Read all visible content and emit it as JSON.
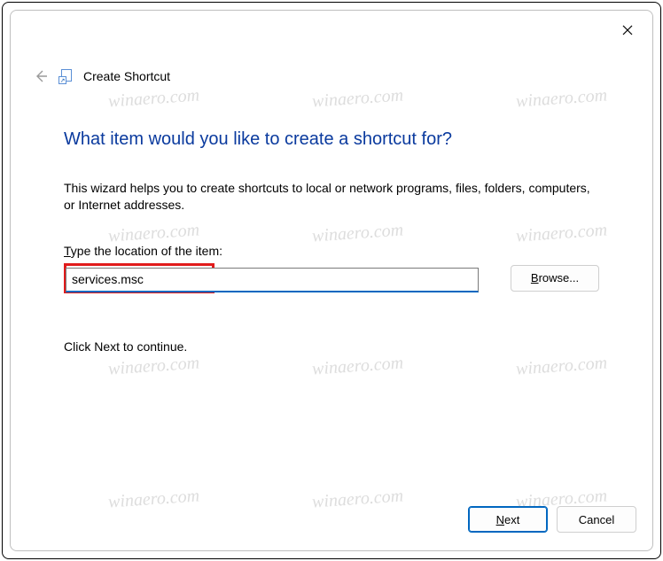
{
  "window": {
    "title": "Create Shortcut",
    "close_label": "Close"
  },
  "wizard": {
    "heading": "What item would you like to create a shortcut for?",
    "description": "This wizard helps you to create shortcuts to local or network programs, files, folders, computers, or Internet addresses.",
    "location_label_pre": "T",
    "location_label_post": "ype the location of the item:",
    "location_value": "services.msc",
    "browse_pre": "B",
    "browse_post": "rowse...",
    "continue_text": "Click Next to continue."
  },
  "footer": {
    "next_pre": "N",
    "next_post": "ext",
    "cancel": "Cancel"
  },
  "watermark": "winaero.com"
}
